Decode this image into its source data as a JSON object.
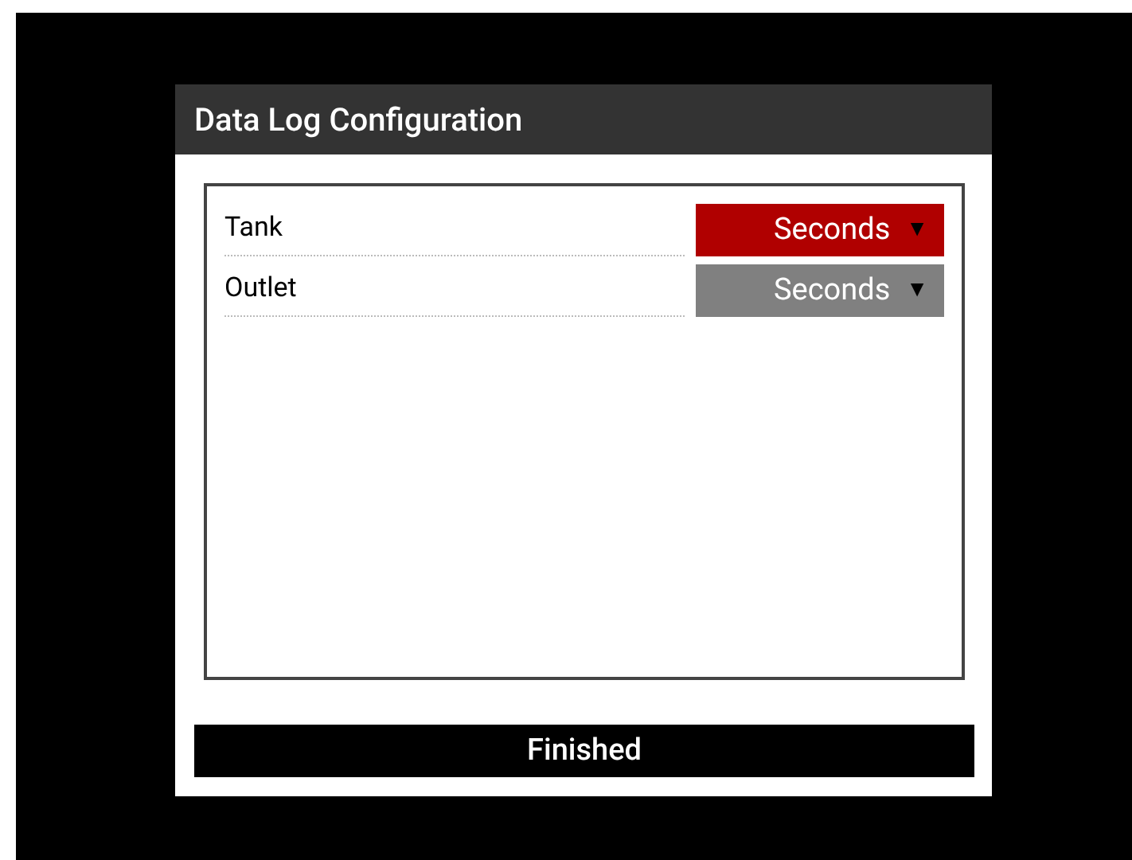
{
  "dialog": {
    "title": "Data Log Configuration",
    "rows": [
      {
        "label": "Tank",
        "value": "Seconds",
        "arrow": "▼",
        "selected": true
      },
      {
        "label": "Outlet",
        "value": "Seconds",
        "arrow": "▼",
        "selected": false
      }
    ],
    "button": "Finished"
  }
}
